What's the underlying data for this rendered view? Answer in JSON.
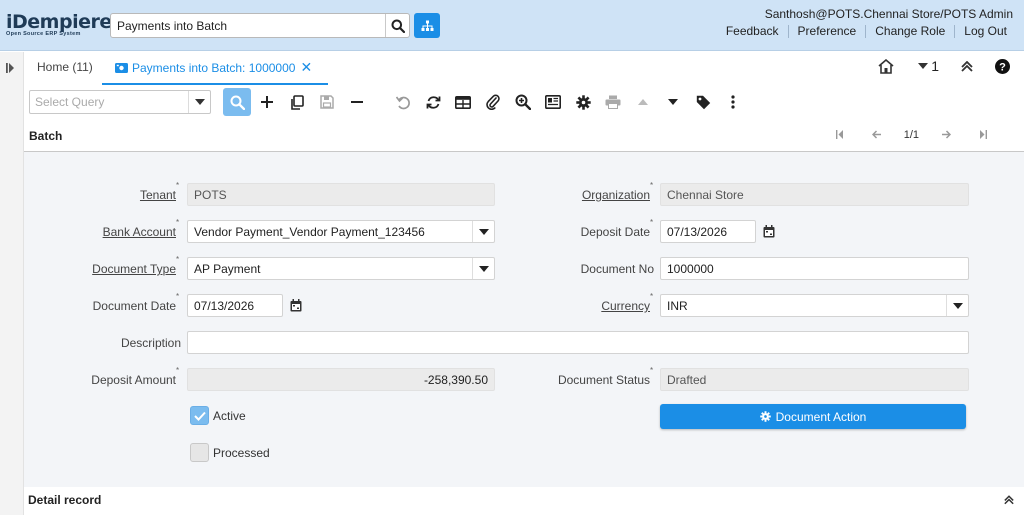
{
  "header": {
    "logo_main": "iDempiere",
    "logo_sub": "Open Source   ERP System",
    "search_value": "Payments into Batch",
    "user": "Santhosh@POTS.Chennai Store/POTS Admin",
    "links": [
      "Feedback",
      "Preference",
      "Change Role",
      "Log Out"
    ]
  },
  "tabs": {
    "home": "Home (11)",
    "active": "Payments into Batch: 1000000",
    "window_count": "1"
  },
  "toolbar": {
    "query_placeholder": "Select Query"
  },
  "section": {
    "title": "Batch",
    "record_count": "1/1"
  },
  "form": {
    "tenant_label": "Tenant",
    "tenant_value": "POTS",
    "organization_label": "Organization",
    "organization_value": "Chennai Store",
    "bank_account_label": "Bank Account",
    "bank_account_value": "Vendor Payment_Vendor Payment_123456",
    "deposit_date_label": "Deposit Date",
    "deposit_date_value": "07/13/2026",
    "document_type_label": "Document Type",
    "document_type_value": "AP Payment",
    "document_no_label": "Document No",
    "document_no_value": "1000000",
    "document_date_label": "Document Date",
    "document_date_value": "07/13/2026",
    "currency_label": "Currency",
    "currency_value": "INR",
    "description_label": "Description",
    "description_value": "",
    "deposit_amount_label": "Deposit Amount",
    "deposit_amount_value": "-258,390.50",
    "document_status_label": "Document Status",
    "document_status_value": "Drafted",
    "active_label": "Active",
    "active_checked": true,
    "processed_label": "Processed",
    "processed_checked": false,
    "document_action_label": "Document Action"
  },
  "detail": {
    "title": "Detail record"
  },
  "colors": {
    "header_bg": "#cfe3f6",
    "accent": "#1b8ee6",
    "form_bg": "#f3f5f8"
  }
}
